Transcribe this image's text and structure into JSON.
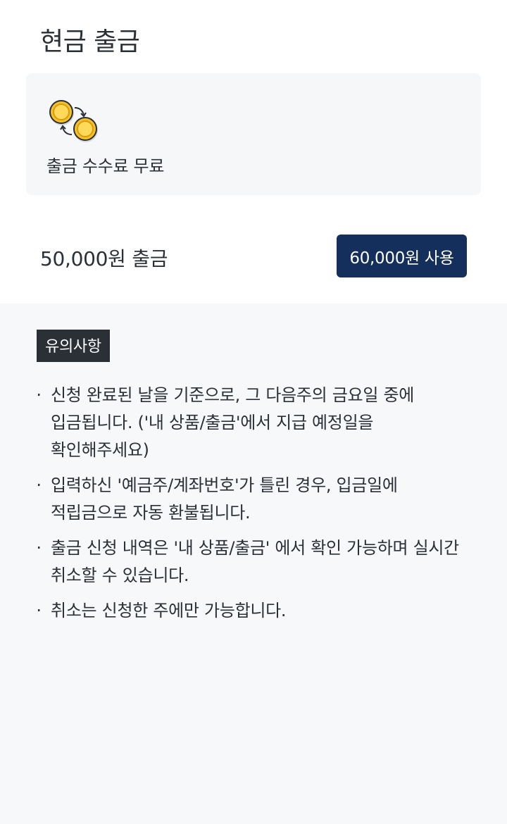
{
  "header": {
    "title": "현금 출금"
  },
  "fee_card": {
    "icon": "coin-exchange-icon",
    "text": "출금 수수료 무료"
  },
  "withdraw": {
    "amount_label": "50,000원 출금",
    "use_button_label": "60,000원 사용",
    "button_color": "#142f5c"
  },
  "notice": {
    "badge": "유의사항",
    "items": [
      "신청 완료된 날을 기준으로, 그 다음주의 금요일 중에 입금됩니다. ('내 상품/출금'에서 지급 예정일을 확인해주세요)",
      "입력하신 '예금주/계좌번호'가 틀린 경우, 입금일에 적립금으로 자동 환불됩니다.",
      "출금 신청 내역은 '내 상품/출금' 에서 확인 가능하며 실시간 취소할 수 있습니다.",
      "취소는 신청한 주에만 가능합니다."
    ],
    "bullet": "·"
  }
}
